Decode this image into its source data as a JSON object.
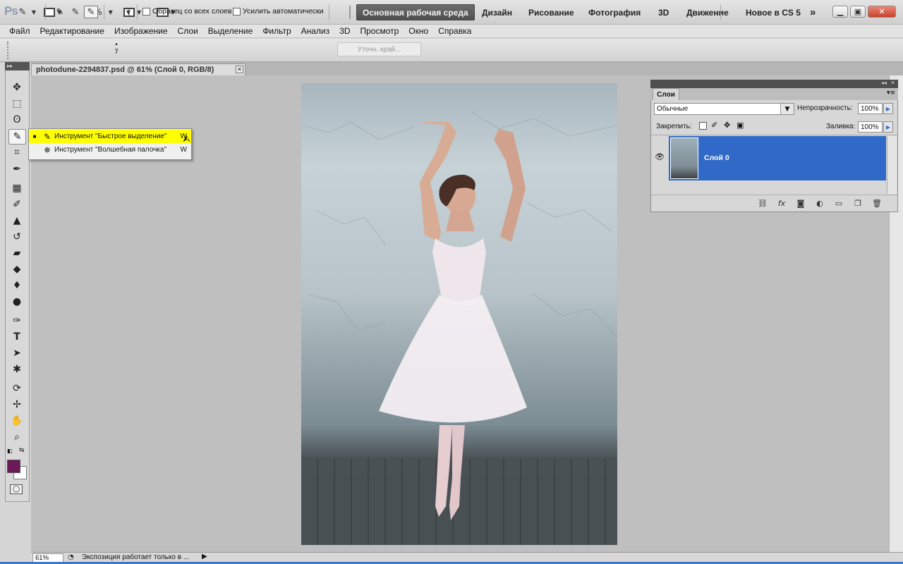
{
  "app": {
    "logo": "Ps",
    "zoom_dropdown": "61%"
  },
  "workspaces": {
    "active": "Основная рабочая среда",
    "items": [
      "Дизайн",
      "Рисование",
      "Фотография",
      "3D",
      "Движение",
      "Новое в CS 5"
    ],
    "more": "»"
  },
  "menu": [
    "Файл",
    "Редактирование",
    "Изображение",
    "Слои",
    "Выделение",
    "Фильтр",
    "Анализ",
    "3D",
    "Просмотр",
    "Окно",
    "Справка"
  ],
  "options": {
    "brush_size": "7",
    "sample_all_label": "Образец со всех слоев",
    "auto_enhance_label": "Усилить автоматически",
    "refine_edge_label": "Уточн. край..."
  },
  "document": {
    "tab_title": "photodune-2294837.psd @ 61% (Слой 0, RGB/8)"
  },
  "flyout": {
    "items": [
      {
        "label": "Инструмент \"Быстрое выделение\"",
        "key": "W"
      },
      {
        "label": "Инструмент \"Волшебная палочка\"",
        "key": "W"
      }
    ]
  },
  "colors": {
    "foreground": "#6b1a57",
    "background": "#ffffff",
    "layer_selected": "#3069c7"
  },
  "layers_panel": {
    "tab": "Слои",
    "blend_mode": "Обычные",
    "opacity_label": "Непрозрачность:",
    "opacity_value": "100%",
    "lock_label": "Закрепить:",
    "fill_label": "Заливка:",
    "fill_value": "100%",
    "layers": [
      {
        "name": "Слой 0"
      }
    ]
  },
  "status": {
    "zoom": "61%",
    "message": "Экспозиция работает только в ..."
  }
}
